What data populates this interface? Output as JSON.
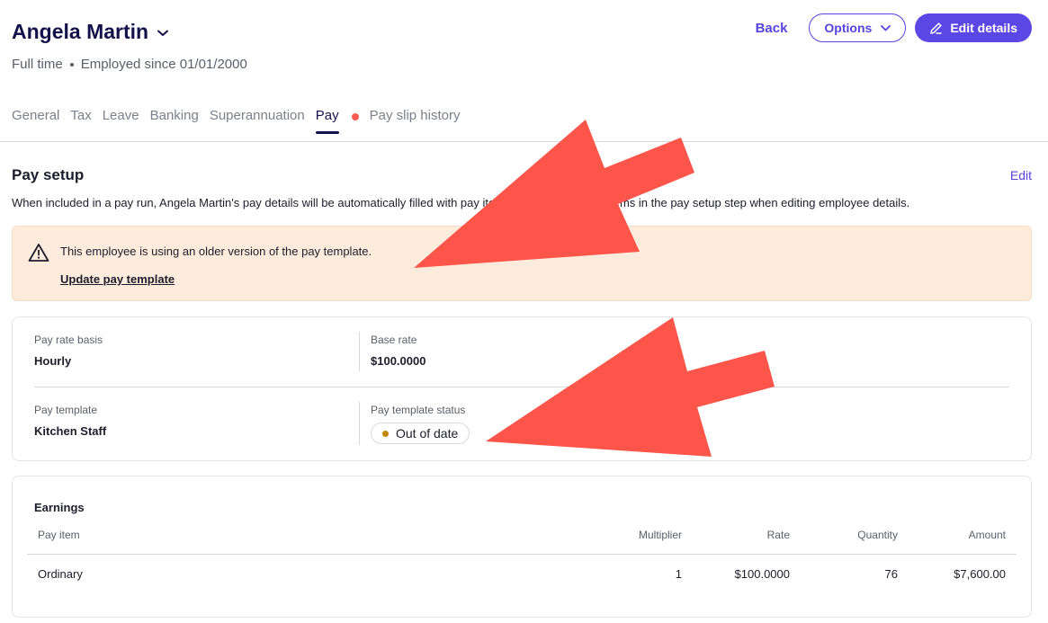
{
  "header": {
    "name": "Angela Martin",
    "employment_type": "Full time",
    "employed_since": "Employed since 01/01/2000",
    "back_label": "Back",
    "options_label": "Options",
    "edit_label": "Edit details"
  },
  "tabs": [
    {
      "label": "General"
    },
    {
      "label": "Tax"
    },
    {
      "label": "Leave"
    },
    {
      "label": "Banking"
    },
    {
      "label": "Superannuation"
    },
    {
      "label": "Pay"
    },
    {
      "label": "Pay slip history"
    }
  ],
  "pay_setup": {
    "title": "Pay setup",
    "edit_label": "Edit",
    "description": "When included in a pay run, Angela Martin's pay details will be automatically filled with pay items. You can manage items in the pay setup step when editing employee details.",
    "warning_text": "This employee is using an older version of the pay template.",
    "warning_link": "Update pay template",
    "pay_rate_basis_label": "Pay rate basis",
    "pay_rate_basis_value": "Hourly",
    "base_rate_label": "Base rate",
    "base_rate_value": "$100.0000",
    "pay_template_label": "Pay template",
    "pay_template_value": "Kitchen Staff",
    "pay_template_status_label": "Pay template status",
    "pay_template_status_value": "Out of date"
  },
  "earnings": {
    "title": "Earnings",
    "columns": [
      "Pay item",
      "Multiplier",
      "Rate",
      "Quantity",
      "Amount"
    ],
    "rows": [
      {
        "pay_item": "Ordinary",
        "multiplier": "1",
        "rate": "$100.0000",
        "quantity": "76",
        "amount": "$7,600.00"
      }
    ]
  },
  "colors": {
    "accent": "#5b47e6",
    "title": "#14124a",
    "warning_bg": "#fdecdc",
    "status_dot": "#c2860b",
    "tab_alert_dot": "#ff5a4e",
    "annotation_arrow": "#fd5549"
  },
  "icons": {
    "name_dropdown": "chevron-down-icon",
    "options_dropdown": "chevron-down-icon",
    "edit": "pencil-icon",
    "warning": "warning-triangle-icon"
  }
}
